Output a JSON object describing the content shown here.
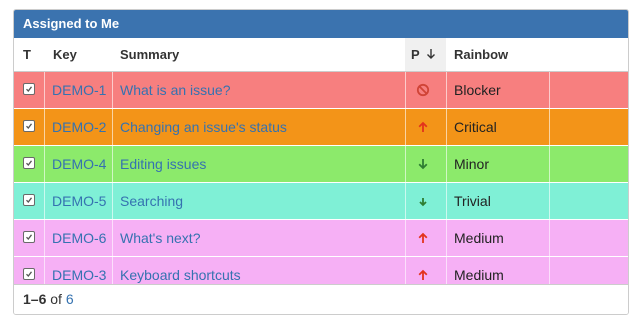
{
  "gadget": {
    "title": "Assigned to Me"
  },
  "columns": {
    "type": "T",
    "key": "Key",
    "summary": "Summary",
    "priority": "P",
    "rainbow": "Rainbow"
  },
  "colors": {
    "header_bg": "#3b73af",
    "link": "#3572b0"
  },
  "rows": [
    {
      "key": "DEMO-1",
      "summary": "What is an issue?",
      "priority_icon": "blocker-icon",
      "rainbow": "Blocker",
      "bg": "#f77f7f"
    },
    {
      "key": "DEMO-2",
      "summary": "Changing an issue's status",
      "priority_icon": "arrow-up-icon",
      "rainbow": "Critical",
      "bg": "#f39418"
    },
    {
      "key": "DEMO-4",
      "summary": "Editing issues",
      "priority_icon": "arrow-down-icon",
      "rainbow": "Minor",
      "bg": "#8cea6b"
    },
    {
      "key": "DEMO-5",
      "summary": "Searching",
      "priority_icon": "arrow-down-small-icon",
      "rainbow": "Trivial",
      "bg": "#7ff0d6"
    },
    {
      "key": "DEMO-6",
      "summary": "What's next?",
      "priority_icon": "arrow-up-icon",
      "rainbow": "Medium",
      "bg": "#f6b0f5"
    },
    {
      "key": "DEMO-3",
      "summary": "Keyboard shortcuts",
      "priority_icon": "arrow-up-icon",
      "rainbow": "Medium",
      "bg": "#f6b0f5"
    }
  ],
  "footer": {
    "range": "1–6",
    "of": "of",
    "total": "6"
  }
}
